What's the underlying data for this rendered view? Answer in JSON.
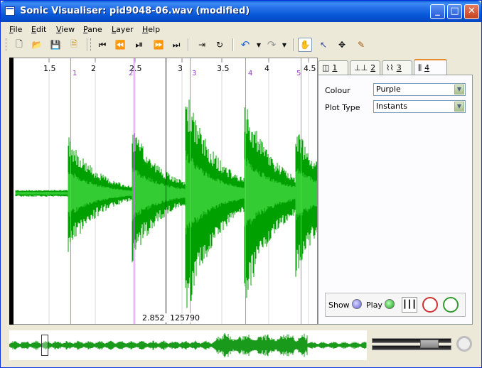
{
  "window": {
    "title": "Sonic Visualiser: pid9048-06.wav (modified)",
    "minimize": "_",
    "maximize": "□",
    "close": "✕"
  },
  "menu": [
    {
      "first": "F",
      "rest": "ile"
    },
    {
      "first": "E",
      "rest": "dit"
    },
    {
      "first": "V",
      "rest": "iew"
    },
    {
      "first": "P",
      "rest": "ane"
    },
    {
      "first": "L",
      "rest": "ayer"
    },
    {
      "first": "H",
      "rest": "elp"
    }
  ],
  "toolbar": {
    "icons": [
      "new-file-icon",
      "open-icon",
      "save-icon",
      "save-session-icon",
      "rewind-start-icon",
      "rewind-icon",
      "play-pause-icon",
      "fast-forward-icon",
      "fast-forward-end-icon",
      "play-selection-icon",
      "loop-icon",
      "undo-icon",
      "redo-icon",
      "navigate-tool-icon",
      "select-tool-icon",
      "move-tool-icon",
      "draw-tool-icon"
    ],
    "glyphs": {
      "new": "🗋",
      "open": "📂",
      "save": "💾",
      "session": "🗎",
      "rs": "⏮",
      "rw": "⏪",
      "pp": "⏯",
      "ff": "⏩",
      "fe": "⏭",
      "psel": "⇥",
      "loop": "↻",
      "undo": "↶",
      "redo": "↷",
      "nav": "✋",
      "sel": "↖",
      "move": "✥",
      "draw": "✎"
    }
  },
  "pane": {
    "ruler": [
      "1.5",
      "2",
      "2.5",
      "3",
      "3.5",
      "4",
      "4.5"
    ],
    "instants": [
      "1",
      "2",
      "3",
      "4",
      "5"
    ],
    "readout_time": "2.852",
    "readout_frame": "125790",
    "wave_color": "#00a000",
    "wave_light": "#33cc33",
    "instant_color": "#c87be0"
  },
  "panel": {
    "tabs": [
      "1",
      "2",
      "3",
      "4"
    ],
    "active_tab": 3,
    "colour_label": "Colour",
    "colour_value": "Purple",
    "plot_type_label": "Plot Type",
    "plot_type_value": "Instants",
    "show_label": "Show",
    "play_label": "Play"
  }
}
